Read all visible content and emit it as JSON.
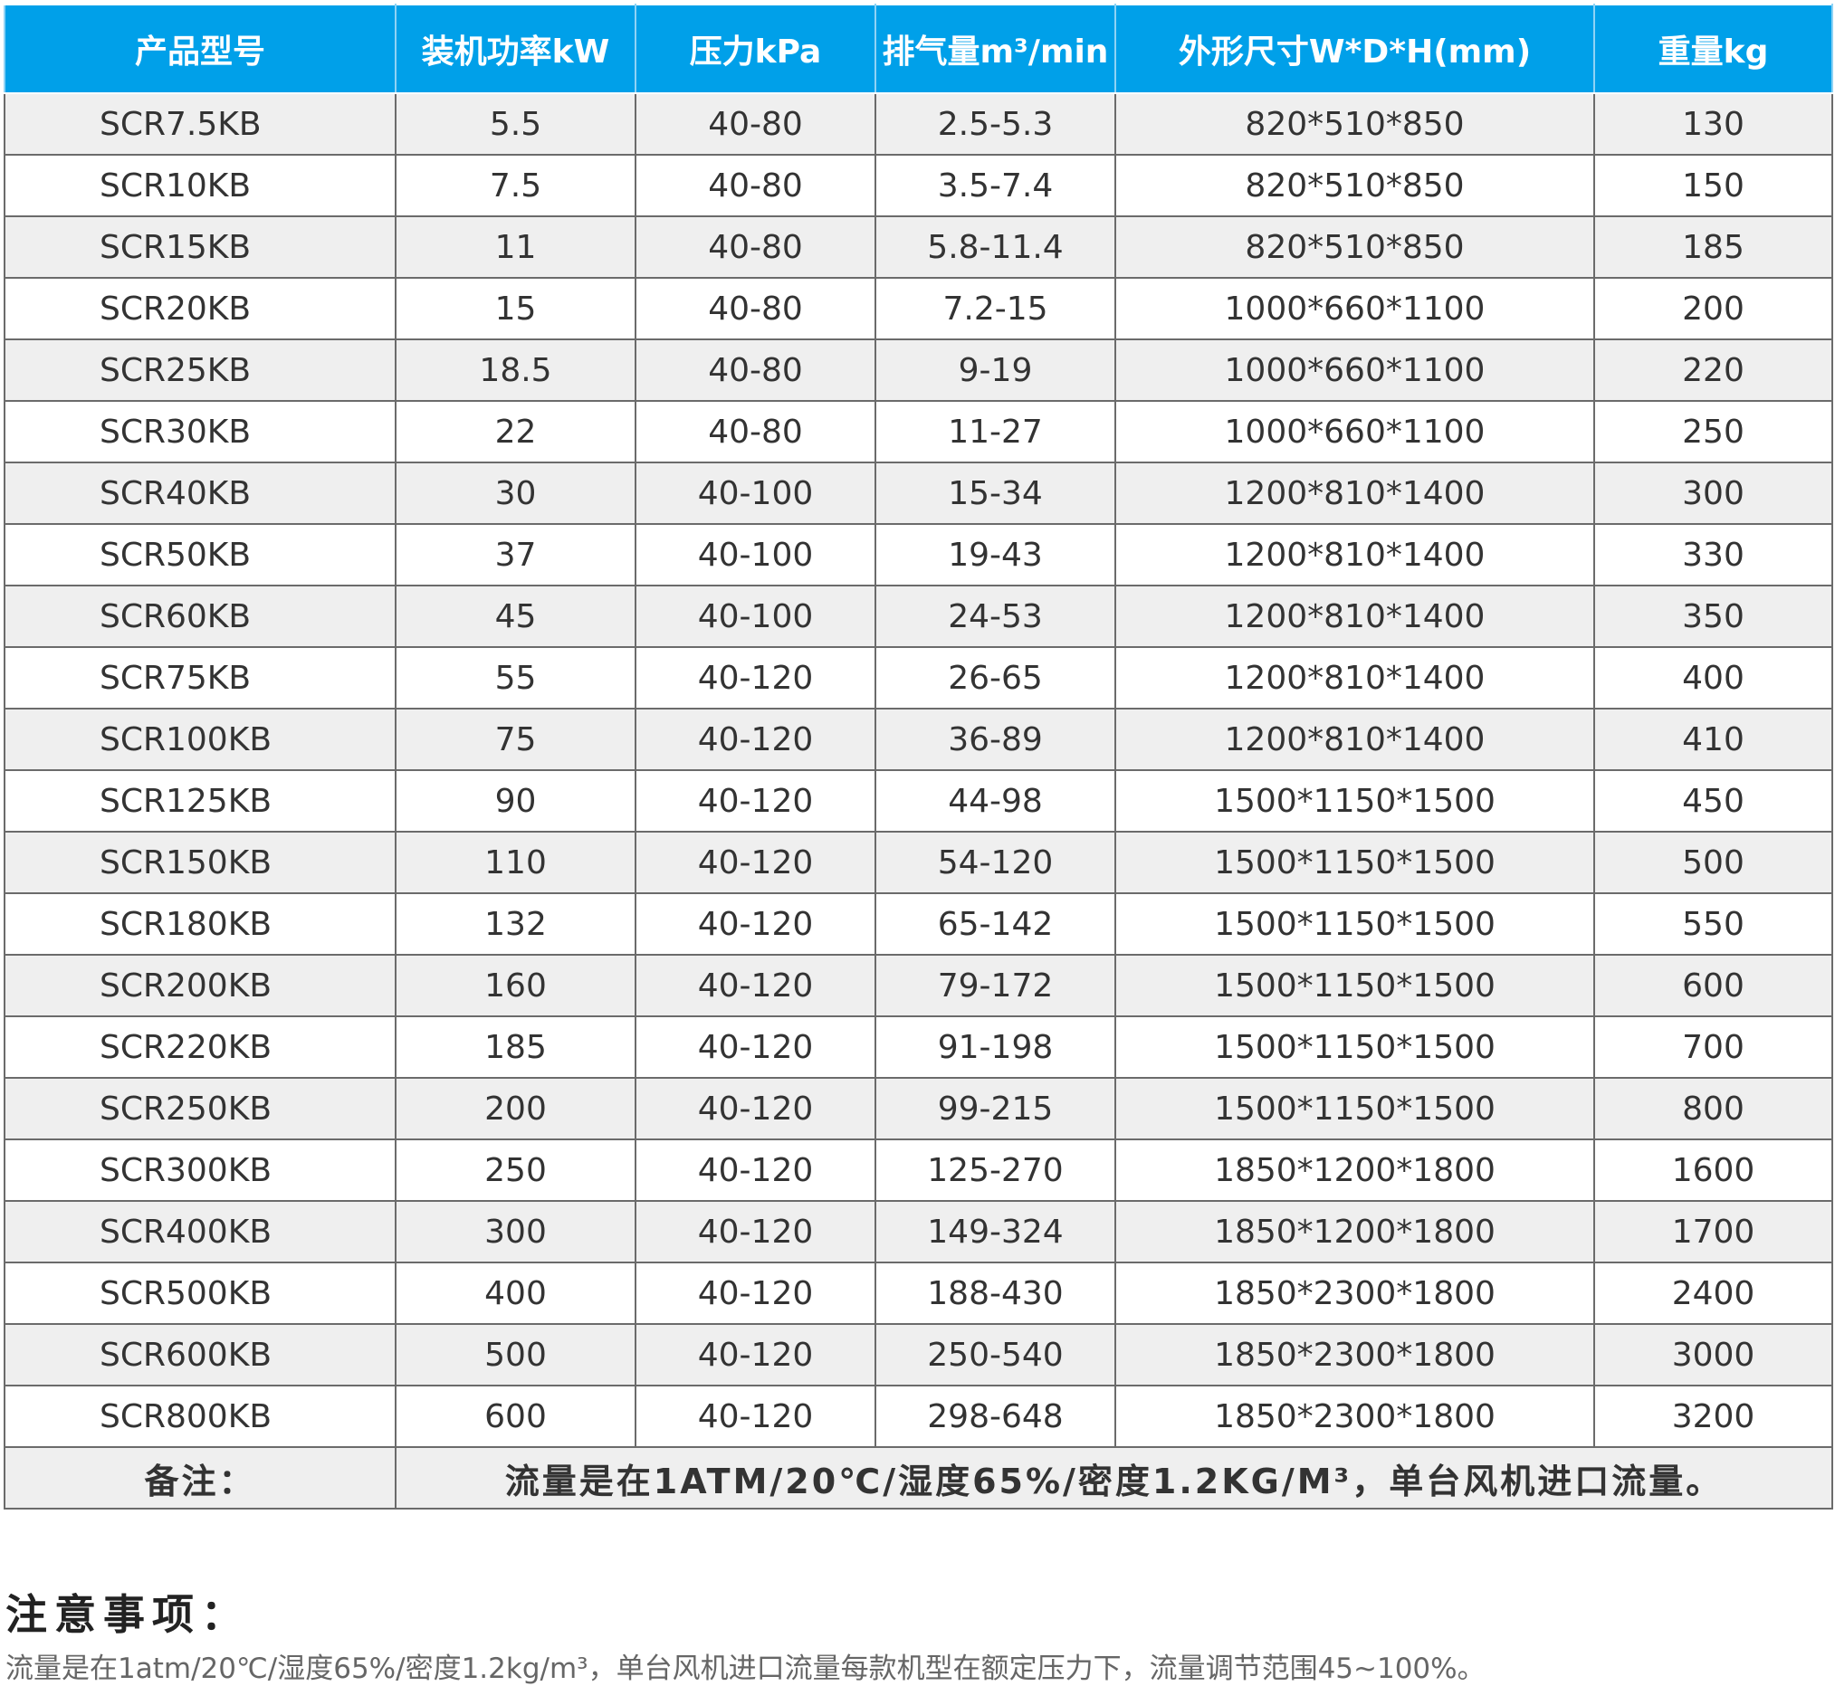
{
  "table": {
    "headers": [
      "产品型号",
      "装机功率kW",
      "压力kPa",
      "排气量m³/min",
      "外形尺寸W*D*H(mm)",
      "重量kg"
    ],
    "rows": [
      [
        "SCR7.5KB",
        "5.5",
        "40-80",
        "2.5-5.3",
        "820*510*850",
        "130"
      ],
      [
        "SCR10KB",
        "7.5",
        "40-80",
        "3.5-7.4",
        "820*510*850",
        "150"
      ],
      [
        "SCR15KB",
        "11",
        "40-80",
        "5.8-11.4",
        "820*510*850",
        "185"
      ],
      [
        "SCR20KB",
        "15",
        "40-80",
        "7.2-15",
        "1000*660*1100",
        "200"
      ],
      [
        "SCR25KB",
        "18.5",
        "40-80",
        "9-19",
        "1000*660*1100",
        "220"
      ],
      [
        "SCR30KB",
        "22",
        "40-80",
        "11-27",
        "1000*660*1100",
        "250"
      ],
      [
        "SCR40KB",
        "30",
        "40-100",
        "15-34",
        "1200*810*1400",
        "300"
      ],
      [
        "SCR50KB",
        "37",
        "40-100",
        "19-43",
        "1200*810*1400",
        "330"
      ],
      [
        "SCR60KB",
        "45",
        "40-100",
        "24-53",
        "1200*810*1400",
        "350"
      ],
      [
        "SCR75KB",
        "55",
        "40-120",
        "26-65",
        "1200*810*1400",
        "400"
      ],
      [
        "SCR100KB",
        "75",
        "40-120",
        "36-89",
        "1200*810*1400",
        "410"
      ],
      [
        "SCR125KB",
        "90",
        "40-120",
        "44-98",
        "1500*1150*1500",
        "450"
      ],
      [
        "SCR150KB",
        "110",
        "40-120",
        "54-120",
        "1500*1150*1500",
        "500"
      ],
      [
        "SCR180KB",
        "132",
        "40-120",
        "65-142",
        "1500*1150*1500",
        "550"
      ],
      [
        "SCR200KB",
        "160",
        "40-120",
        "79-172",
        "1500*1150*1500",
        "600"
      ],
      [
        "SCR220KB",
        "185",
        "40-120",
        "91-198",
        "1500*1150*1500",
        "700"
      ],
      [
        "SCR250KB",
        "200",
        "40-120",
        "99-215",
        "1500*1150*1500",
        "800"
      ],
      [
        "SCR300KB",
        "250",
        "40-120",
        "125-270",
        "1850*1200*1800",
        "1600"
      ],
      [
        "SCR400KB",
        "300",
        "40-120",
        "149-324",
        "1850*1200*1800",
        "1700"
      ],
      [
        "SCR500KB",
        "400",
        "40-120",
        "188-430",
        "1850*2300*1800",
        "2400"
      ],
      [
        "SCR600KB",
        "500",
        "40-120",
        "250-540",
        "1850*2300*1800",
        "3000"
      ],
      [
        "SCR800KB",
        "600",
        "40-120",
        "298-648",
        "1850*2300*1800",
        "3200"
      ]
    ],
    "remark_label": "备注：",
    "remark_text": "流量是在1ATM/20℃/湿度65%/密度1.2KG/M³，单台风机进口流量。"
  },
  "notes": {
    "title": "注意事项：",
    "text": "流量是在1atm/20℃/湿度65%/密度1.2kg/m³，单台风机进口流量每款机型在额定压力下，流量调节范围45~100%。"
  },
  "colors": {
    "header_bg": "#00a0e9",
    "header_text": "#ffffff",
    "row_alt_bg": "#efefef",
    "border": "#6b6b6b"
  }
}
